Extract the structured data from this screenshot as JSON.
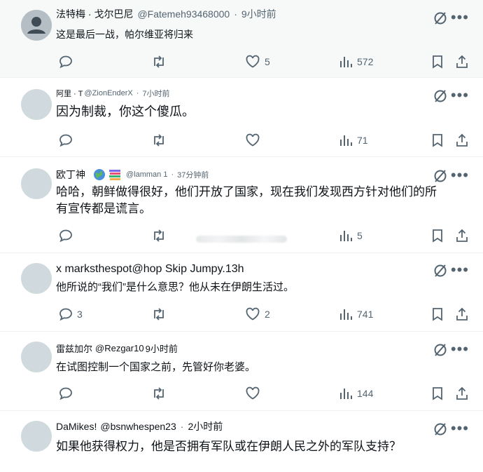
{
  "posts": [
    {
      "name": "法特梅 · 戈尔巴尼",
      "handle": "@Fatemeh93468000",
      "dot": "·",
      "time": "9小时前",
      "text": [
        "这是最后一战，帕尔维亚将归来"
      ],
      "replies": "",
      "reposts": "",
      "likes": "5",
      "views": "572"
    },
    {
      "name": "阿里 · T",
      "handle": "@ZionEnderX",
      "dot": "·",
      "time": "7小时前",
      "text": [
        "因为制裁，你这个傻瓜。"
      ],
      "replies": "",
      "reposts": "",
      "likes": "",
      "views": "71"
    },
    {
      "name": "欧丁神",
      "handle": "@lamman 1",
      "dot": "·",
      "time": "37分钟前",
      "text": [
        "哈哈，朝鲜做得很好，他们开放了国家，现在我们发现西方针对他们的所",
        "有宣传都是谎言。"
      ],
      "replies": "",
      "reposts": "",
      "likes": "",
      "views": "5"
    },
    {
      "name": "x marksthespot@hop Skip Jumpy.13h",
      "handle": "",
      "dot": "",
      "time": "",
      "text": [
        "他所说的“我们”是什么意思？他从未在伊朗生活过。"
      ],
      "replies": "3",
      "reposts": "",
      "likes": "2",
      "views": "741"
    },
    {
      "name": "雷兹加尔",
      "handle": "@Rezgar10",
      "dot": "",
      "time": "9小时前",
      "text": [
        "在试图控制一个国家之前，先管好你老婆。"
      ],
      "replies": "",
      "reposts": "",
      "likes": "",
      "views": "144"
    },
    {
      "name": "DaMikes!",
      "handle": "@bsnwhespen23",
      "dot": "·",
      "time": "2小时前",
      "text": [
        "如果他获得权力，他是否拥有军队或在伊朗人民之外的军队支持？"
      ],
      "replies": "",
      "reposts": "",
      "likes": "",
      "views": ""
    }
  ],
  "icons": {
    "reply": "reply-icon",
    "repost": "repost-icon",
    "like": "heart-icon",
    "views": "views-icon",
    "bookmark": "bookmark-icon",
    "share": "share-icon",
    "translate": "translate-icon",
    "more": "more-icon"
  },
  "colors": {
    "text": "#0f1419",
    "muted": "#536471",
    "avatar": "#cfd9de",
    "highlight": "#f7f9f9"
  }
}
